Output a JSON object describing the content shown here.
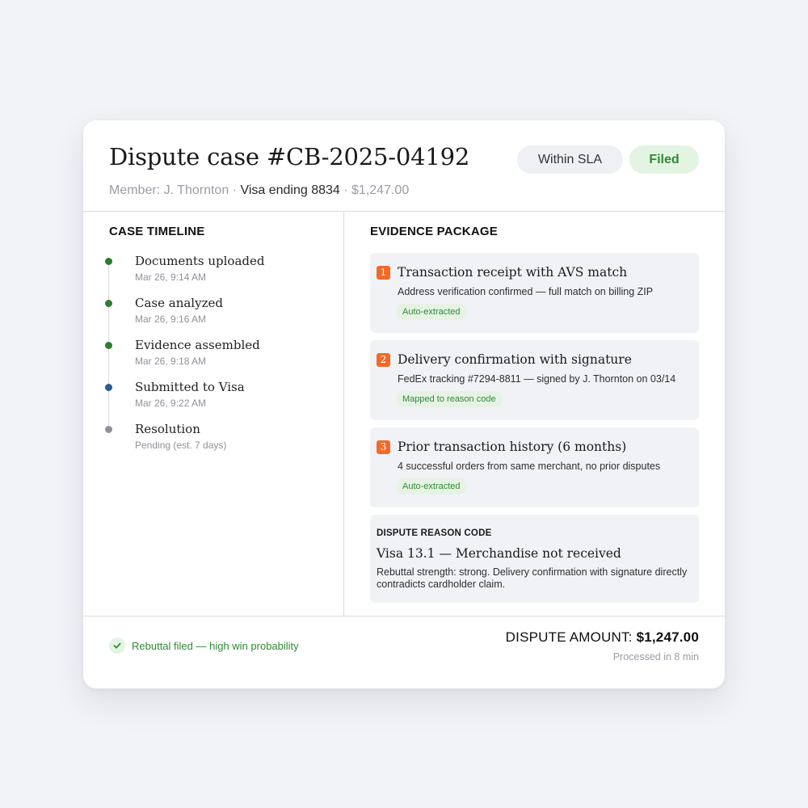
{
  "header": {
    "title": "Dispute case #CB-2025-04192",
    "member": "Member: J. Thornton",
    "separator": " · ",
    "card": "Visa ending 8834",
    "amount": "$1,247.00",
    "sla_badge": "Within SLA",
    "status_badge": "Filed"
  },
  "timeline": {
    "title": "CASE TIMELINE",
    "items": [
      {
        "label": "Documents uploaded",
        "time": "Mar 26, 9:14 AM",
        "state": "done",
        "color": "#2e7d32"
      },
      {
        "label": "Case analyzed",
        "time": "Mar 26, 9:16 AM",
        "state": "done",
        "color": "#2e7d32"
      },
      {
        "label": "Evidence assembled",
        "time": "Mar 26, 9:18 AM",
        "state": "done",
        "color": "#2e7d32"
      },
      {
        "label": "Submitted to Visa",
        "time": "Mar 26, 9:22 AM",
        "state": "current",
        "color": "#2b5c8f"
      },
      {
        "label": "Resolution",
        "time": "Pending (est. 7 days)",
        "state": "pending",
        "color": "#8f929a"
      }
    ]
  },
  "evidence": {
    "title": "EVIDENCE PACKAGE",
    "items": [
      {
        "num": "1",
        "title": "Transaction receipt with AVS match",
        "desc": "Address verification confirmed — full match on billing ZIP",
        "tag": "Auto-extracted"
      },
      {
        "num": "2",
        "title": "Delivery confirmation with signature",
        "desc": "FedEx tracking #7294-8811 — signed by J. Thornton on 03/14",
        "tag": "Mapped to reason code"
      },
      {
        "num": "3",
        "title": "Prior transaction history (6 months)",
        "desc": "4 successful orders from same merchant, no prior disputes",
        "tag": "Auto-extracted"
      }
    ],
    "reason_code": {
      "label": "DISPUTE REASON CODE",
      "title": "Visa 13.1 — Merchandise not received",
      "text": "Rebuttal strength: strong. Delivery confirmation with signature directly contradicts cardholder claim."
    }
  },
  "footer": {
    "status": "Rebuttal filed — high win probability",
    "amount_label": "DISPUTE AMOUNT: ",
    "amount_value": "$1,247.00",
    "processed": "Processed in 8 min"
  },
  "colors": {
    "accent_green": "#2f8a34",
    "badge_orange": "#f26a2a",
    "background": "#f2f3f7"
  },
  "icons": {
    "status_icon": "check-icon"
  }
}
